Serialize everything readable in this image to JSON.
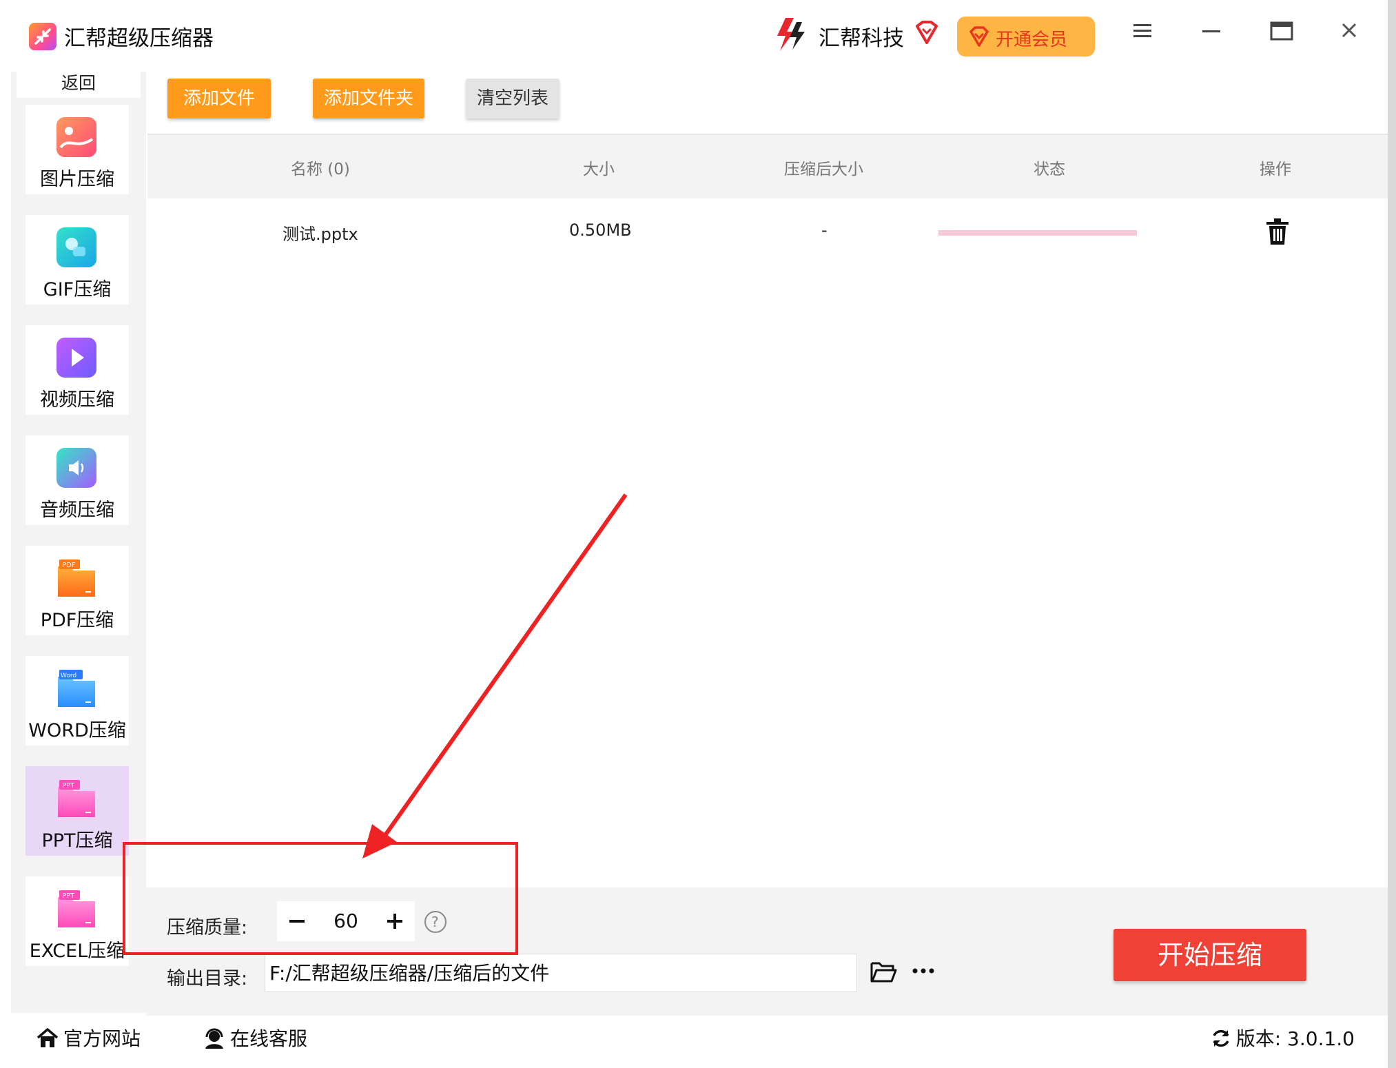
{
  "app": {
    "title": "汇帮超级压缩器",
    "brand": "汇帮科技",
    "vip_label": "开通会员"
  },
  "window_controls": {
    "menu": "menu-icon",
    "minimize": "minimize-icon",
    "maximize": "maximize-icon",
    "close": "close-icon"
  },
  "sidebar": {
    "back": "返回",
    "items": [
      {
        "label": "图片压缩",
        "icon": "image-icon",
        "color": "#ff6b6b"
      },
      {
        "label": "GIF压缩",
        "icon": "gif-icon",
        "color": "#2ec7d8"
      },
      {
        "label": "视频压缩",
        "icon": "video-icon",
        "color": "#9b5cff"
      },
      {
        "label": "音频压缩",
        "icon": "audio-icon",
        "color": "#5aa8ff"
      },
      {
        "label": "PDF压缩",
        "icon": "pdf-icon",
        "color": "#ff8a1f"
      },
      {
        "label": "WORD压缩",
        "icon": "word-icon",
        "color": "#3b9bff"
      },
      {
        "label": "PPT压缩",
        "icon": "ppt-icon",
        "color": "#ff5cc8",
        "active": true
      },
      {
        "label": "EXCEL压缩",
        "icon": "excel-icon",
        "color": "#ff5cc8"
      }
    ]
  },
  "toolbar": {
    "add_file": "添加文件",
    "add_folder": "添加文件夹",
    "clear_list": "清空列表"
  },
  "table": {
    "headers": [
      "名称 (0)",
      "大小",
      "压缩后大小",
      "状态",
      "操作"
    ],
    "rows": [
      {
        "name": "测试.pptx",
        "size": "0.50MB",
        "compressed_size": "-",
        "progress": 0
      }
    ]
  },
  "settings": {
    "quality_label": "压缩质量:",
    "quality_value": "60",
    "output_label": "输出目录:",
    "output_path": "F:/汇帮超级压缩器/压缩后的文件",
    "start_button": "开始压缩"
  },
  "footer": {
    "website": "官方网站",
    "support": "在线客服",
    "version": "版本: 3.0.1.0"
  },
  "colors": {
    "orange": "#ff9a1a",
    "start_red": "#ef4135",
    "vip_gold": "#ffb543",
    "annotation_red": "#ee2222"
  }
}
